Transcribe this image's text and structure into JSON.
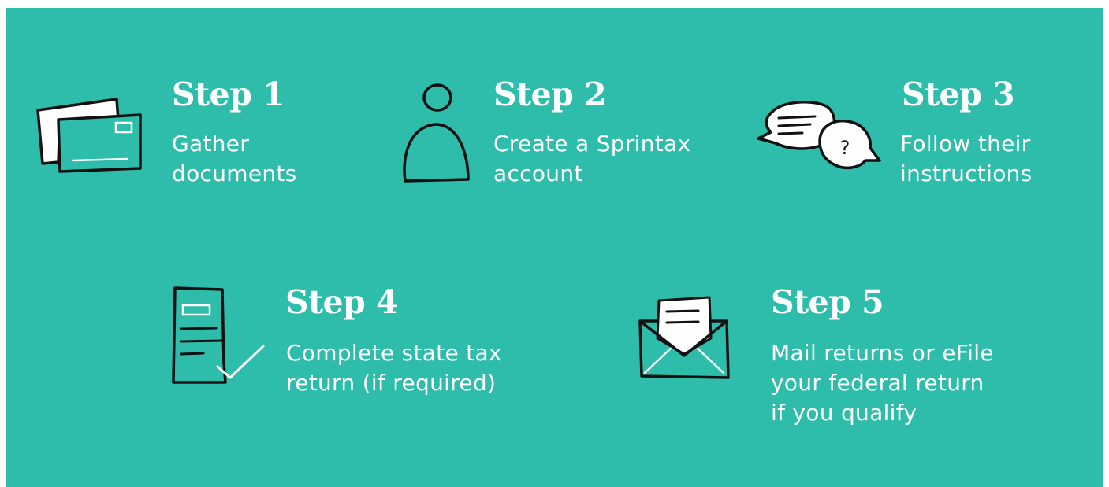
{
  "colors": {
    "background": "#2ebdab",
    "foreground": "#ffffff",
    "ink": "#111111"
  },
  "steps": [
    {
      "title": "Step 1",
      "desc_lines": [
        "Gather",
        "documents"
      ],
      "icon": "envelopes-icon"
    },
    {
      "title": "Step 2",
      "desc_lines": [
        "Create a Sprintax",
        "account"
      ],
      "icon": "person-icon"
    },
    {
      "title": "Step 3",
      "desc_lines": [
        "Follow their",
        "instructions"
      ],
      "icon": "speech-bubbles-icon"
    },
    {
      "title": "Step 4",
      "desc_lines": [
        "Complete state tax",
        "return (if required)"
      ],
      "icon": "document-check-icon"
    },
    {
      "title": "Step 5",
      "desc_lines": [
        "Mail returns or eFile",
        "your federal return",
        "if you qualify"
      ],
      "icon": "open-envelope-icon"
    }
  ]
}
